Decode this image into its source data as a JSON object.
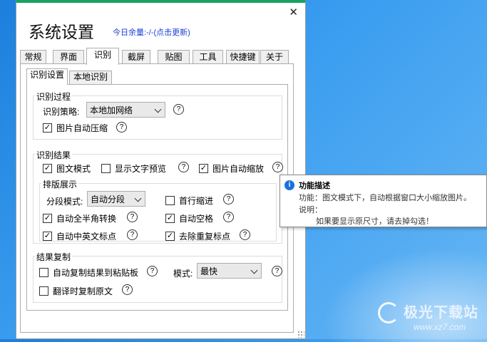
{
  "window": {
    "title": "系统设置",
    "quota_label": "今日余量:-/-",
    "quota_link": "(点击更新)",
    "close_glyph": "✕"
  },
  "tabs": [
    {
      "label": "常规"
    },
    {
      "label": "界面"
    },
    {
      "label": "识别"
    },
    {
      "label": "截屏"
    },
    {
      "label": "贴图"
    },
    {
      "label": "工具"
    },
    {
      "label": "快捷键"
    },
    {
      "label": "关于"
    }
  ],
  "active_tab": "识别",
  "subtabs": [
    {
      "label": "识别设置"
    },
    {
      "label": "本地识别"
    }
  ],
  "recognition_process": {
    "title": "识别过程",
    "strategy_label": "识别策略:",
    "strategy_value": "本地加网络",
    "auto_compress": {
      "label": "图片自动压缩",
      "checked": true
    }
  },
  "recognition_result": {
    "title": "识别结果",
    "image_text_mode": {
      "label": "图文模式",
      "checked": true
    },
    "show_preview": {
      "label": "显示文字预览",
      "checked": false
    },
    "auto_zoom": {
      "label": "图片自动缩放",
      "checked": true
    }
  },
  "layout_display": {
    "title": "排版展示",
    "paragraph_label": "分段模式:",
    "paragraph_value": "自动分段",
    "first_indent": {
      "label": "首行缩进",
      "checked": false
    },
    "auto_width": {
      "label": "自动全半角转换",
      "checked": true
    },
    "auto_space": {
      "label": "自动空格",
      "checked": true
    },
    "auto_punct": {
      "label": "自动中英文标点",
      "checked": true
    },
    "remove_dup": {
      "label": "去除重复标点",
      "checked": true
    }
  },
  "result_copy": {
    "title": "结果复制",
    "auto_copy": {
      "label": "自动复制结果到粘贴板",
      "checked": false
    },
    "mode_label": "模式:",
    "mode_value": "最快",
    "copy_original": {
      "label": "翻译时复制原文",
      "checked": false
    }
  },
  "help_glyph": "?",
  "check_glyph": "✓",
  "tooltip": {
    "icon": "i",
    "title": "功能描述",
    "line1": "功能：图文模式下，自动根据窗口大小缩放图片。",
    "line2": "说明：",
    "line3": "如果要显示原尺寸，请去掉勾选！"
  },
  "watermark": {
    "name": "极光下载站",
    "url": "www.xz7.com"
  },
  "colors": {
    "accent_bar": "#1aa260",
    "link": "#1a3fd6",
    "tooltip_icon": "#1a73d9"
  }
}
